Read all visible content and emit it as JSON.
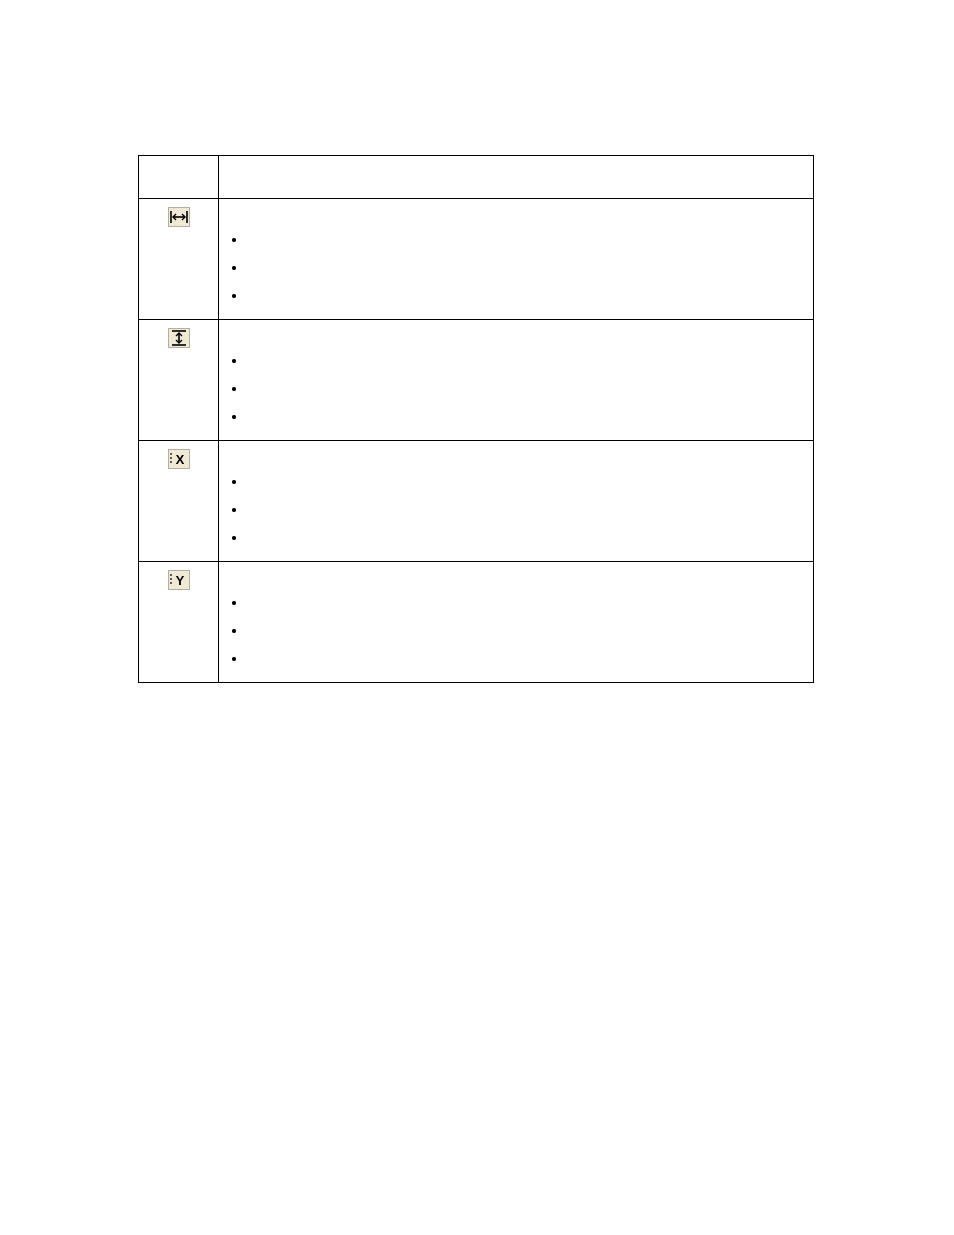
{
  "header": {
    "icon_col": "",
    "desc_col": ""
  },
  "rows": [
    {
      "icon": "fit-horizontal-icon",
      "lead": "",
      "bullets": [
        "",
        "",
        ""
      ]
    },
    {
      "icon": "fit-vertical-icon",
      "lead": "",
      "bullets": [
        "",
        "",
        ""
      ]
    },
    {
      "icon": "set-x-icon",
      "lead": "",
      "bullets": [
        "",
        "",
        ""
      ]
    },
    {
      "icon": "set-y-icon",
      "lead": "",
      "bullets": [
        "",
        "",
        ""
      ]
    }
  ]
}
